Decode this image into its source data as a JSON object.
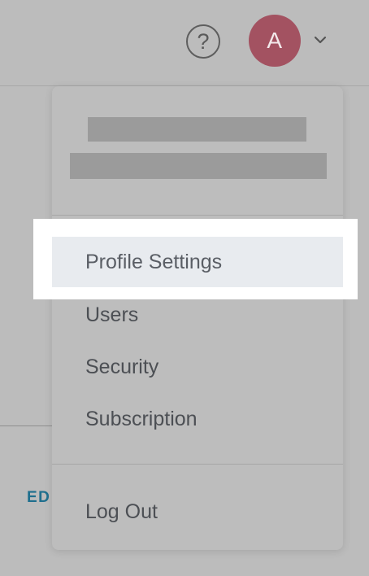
{
  "header": {
    "help_icon": "question-circle-icon",
    "avatar_initial": "A",
    "avatar_color": "#a35261",
    "chevron_icon": "chevron-down-icon"
  },
  "background": {
    "link_text_partial": "ED",
    "link_color": "#1f6f8e"
  },
  "menu": {
    "items": [
      {
        "label": "Profile Settings",
        "highlighted": true
      },
      {
        "label": "Users"
      },
      {
        "label": "Security"
      },
      {
        "label": "Subscription"
      }
    ],
    "logout_label": "Log Out"
  }
}
